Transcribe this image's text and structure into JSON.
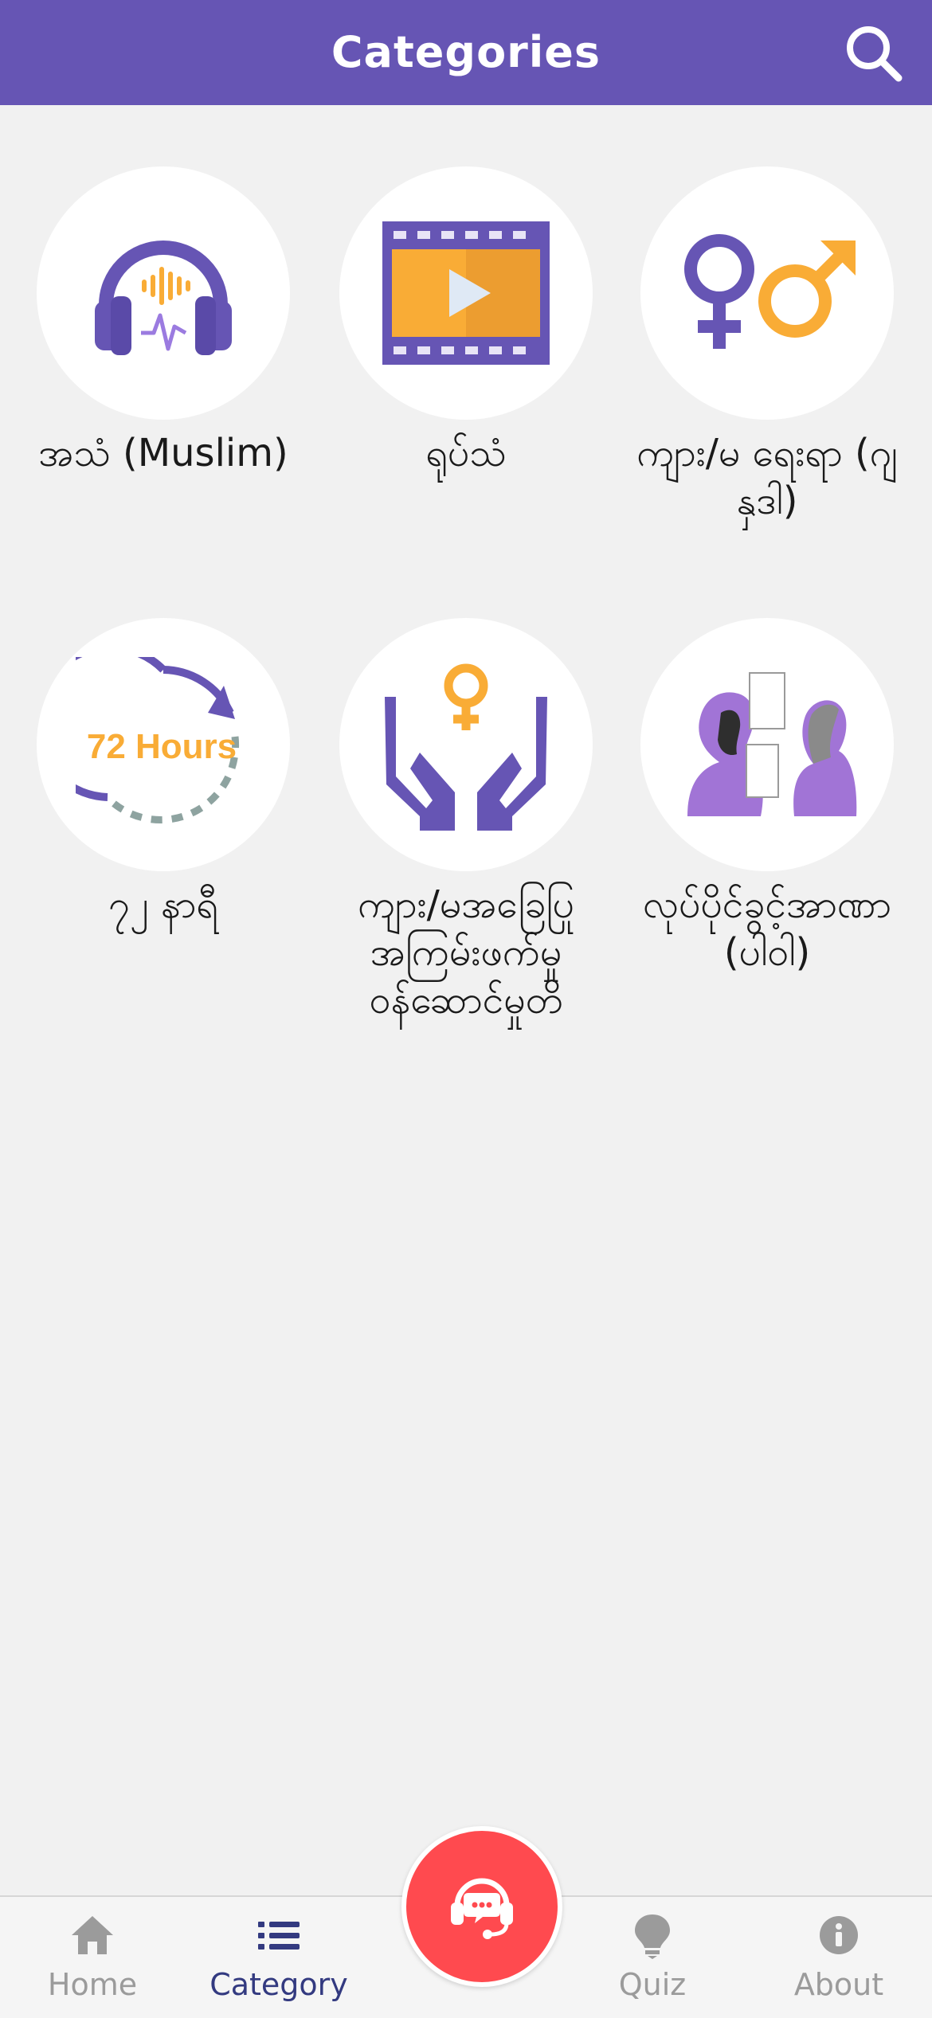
{
  "header": {
    "title": "Categories",
    "search_icon": "search-icon"
  },
  "categories": [
    {
      "label": "အသံ (Muslim)",
      "icon": "headphones-audio-icon"
    },
    {
      "label": "ရုပ်သံ",
      "icon": "video-film-icon"
    },
    {
      "label": "ကျား/မ ရေးရာ (ဂျ နှဒါ)",
      "icon": "gender-symbols-icon"
    },
    {
      "label": "၇၂ နာရီ",
      "icon": "72-hours-icon",
      "icon_text": "72 Hours"
    },
    {
      "label": "ကျား/မအခြေပြု အကြမ်းဖက်မှု ဝန်ဆောင်မှုတိ",
      "icon": "hands-female-symbol-icon"
    },
    {
      "label": "လုပ်ပိုင်ခွင့်အာဏာ (ပါဝါ)",
      "icon": "people-conversation-icon"
    }
  ],
  "bottom_nav": {
    "items": [
      {
        "label": "Home",
        "icon": "home-icon",
        "active": false
      },
      {
        "label": "Category",
        "icon": "list-icon",
        "active": true
      },
      {
        "label": "Quiz",
        "icon": "lightbulb-icon",
        "active": false
      },
      {
        "label": "About",
        "icon": "info-icon",
        "active": false
      }
    ],
    "fab_icon": "support-headset-icon"
  },
  "colors": {
    "header_bg": "#6655b4",
    "purple": "#6655b4",
    "orange": "#f9ac36",
    "fab": "#ff4a4f",
    "nav_active": "#333a80",
    "nav_inactive": "#9b9b9b"
  }
}
